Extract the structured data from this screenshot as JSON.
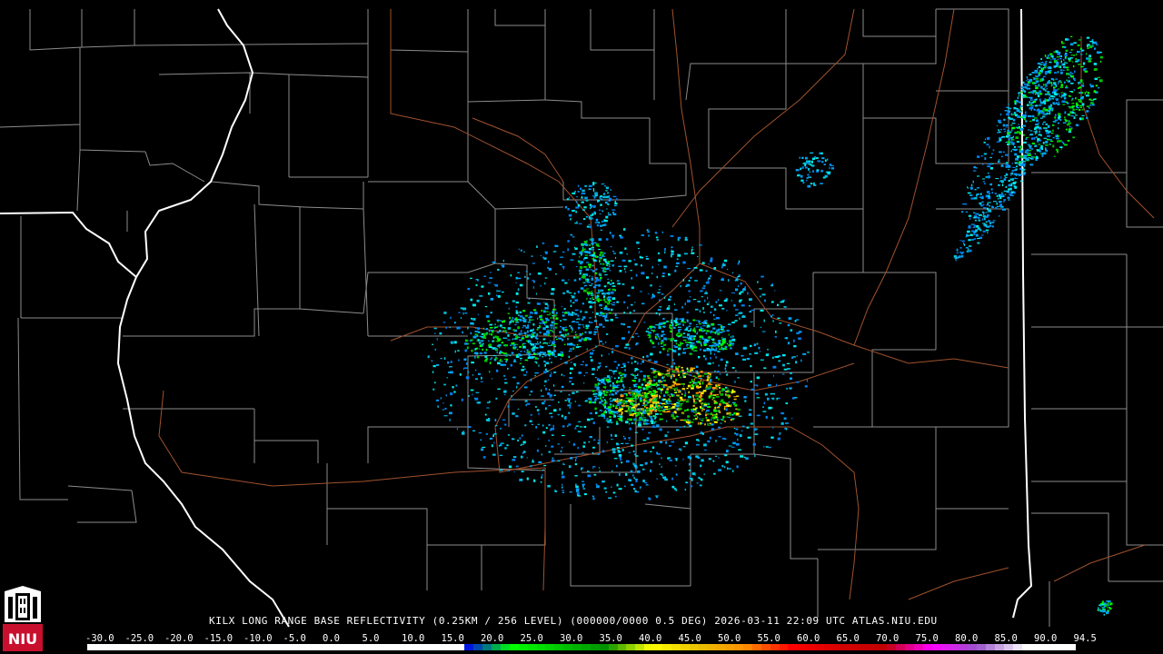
{
  "product": {
    "station": "KILX",
    "name": "LONG RANGE BASE REFLECTIVITY",
    "resolution": "(0.25KM / 256 LEVEL)",
    "volume": "(000000/0000",
    "tilt": "0.5 DEG)",
    "timestamp": "2026-03-11 22:09 UTC",
    "source": "ATLAS.NIU.EDU"
  },
  "logo": {
    "text": "NIU",
    "icon": "niu-tower-logo-icon"
  },
  "scale": {
    "labels": [
      "-30.0",
      "-25.0",
      "-20.0",
      "-15.0",
      "-10.0",
      "-5.0",
      "0.0",
      "5.0",
      "10.0",
      "15.0",
      "20.0",
      "25.0",
      "30.0",
      "35.0",
      "40.0",
      "45.0",
      "50.0",
      "55.0",
      "60.0",
      "65.0",
      "70.0",
      "75.0",
      "80.0",
      "85.0",
      "90.0",
      "94.5"
    ],
    "colors": [
      "#000000",
      "#000000",
      "#000000",
      "#000000",
      "#000000",
      "#000000",
      "#00ecec",
      "#01a0f6",
      "#0000f6",
      "#00ff00",
      "#00c800",
      "#009000",
      "#ffff00",
      "#e7c000",
      "#ff9000",
      "#ff0000",
      "#d60000",
      "#c00000",
      "#ff00ff",
      "#9955c9",
      "#ffffff",
      "#ffffff"
    ]
  },
  "map_colors": {
    "state_borders": "#ffffff",
    "county_lines": "#8c8c8c",
    "highways": "#a0522d"
  }
}
